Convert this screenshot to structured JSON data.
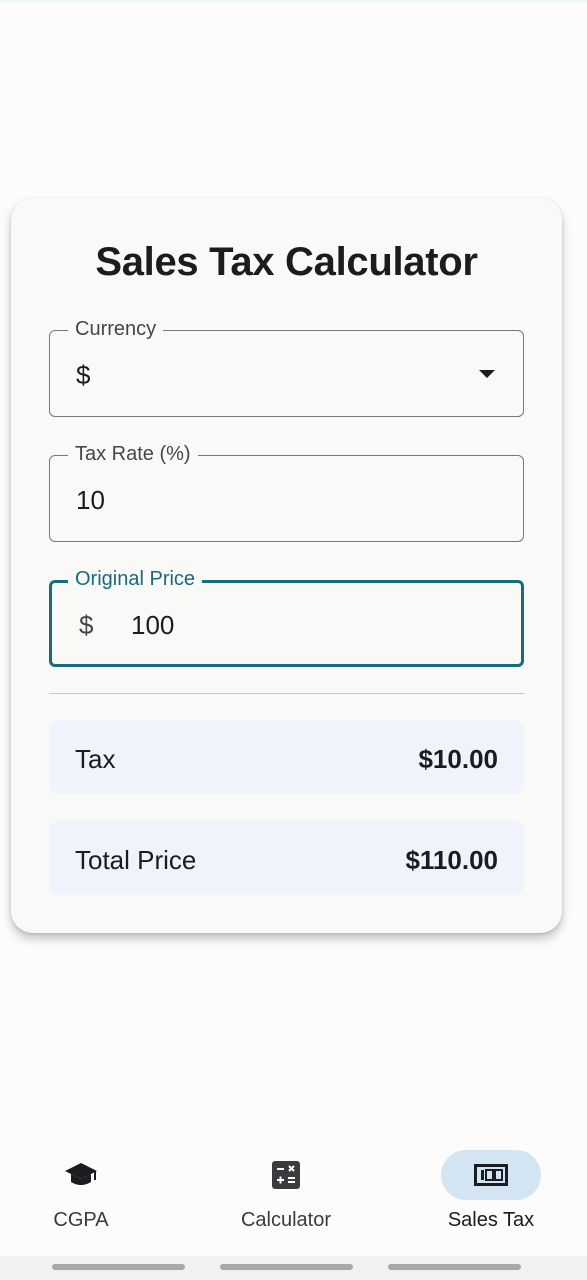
{
  "card": {
    "title": "Sales Tax Calculator",
    "currency": {
      "label": "Currency",
      "value": "$"
    },
    "tax_rate": {
      "label": "Tax Rate (%)",
      "value": "10"
    },
    "original_price": {
      "label": "Original Price",
      "prefix": "$",
      "value": "100"
    },
    "tax": {
      "label": "Tax",
      "value": "$10.00"
    },
    "total": {
      "label": "Total Price",
      "value": "$110.00"
    }
  },
  "nav": {
    "items": [
      {
        "label": "CGPA",
        "icon": "graduation-cap-icon",
        "active": false
      },
      {
        "label": "Calculator",
        "icon": "calculator-icon",
        "active": false
      },
      {
        "label": "Sales Tax",
        "icon": "receipt-icon",
        "active": true
      }
    ]
  },
  "colors": {
    "accent": "#1a6a7f",
    "result_background": "#eef3fc",
    "active_nav_pill": "#d3e5f3",
    "card_background": "#f9f9f8"
  }
}
